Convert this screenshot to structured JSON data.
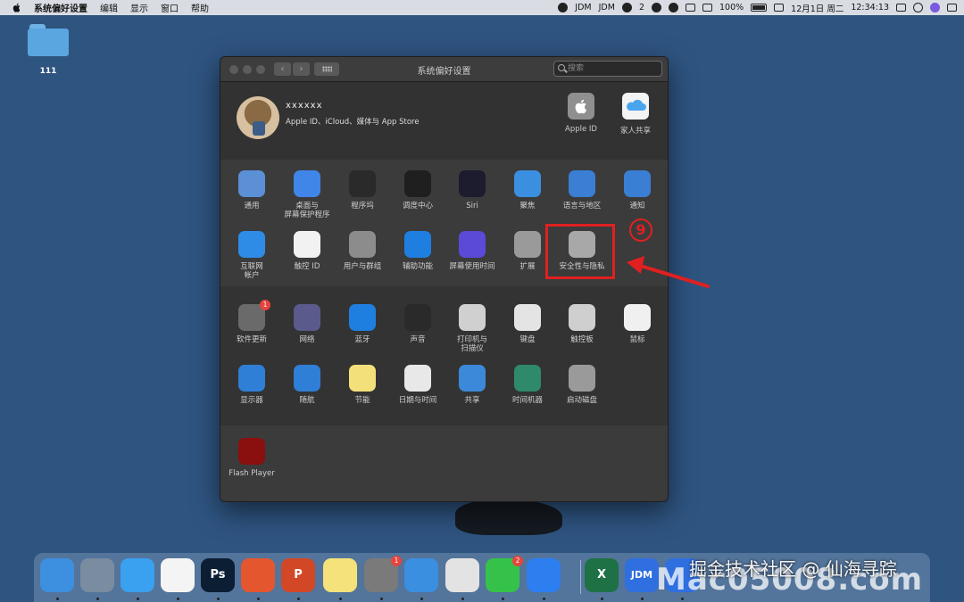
{
  "menubar": {
    "app_name": "系统偏好设置",
    "menus": [
      "编辑",
      "显示",
      "窗口",
      "帮助"
    ],
    "status": {
      "jdm1": "JDM",
      "jdm2": "JDM",
      "wechat_count": "2",
      "battery": "100%",
      "date": "12月1日 周二",
      "time": "12:34:13"
    }
  },
  "desktop": {
    "folder_label": "111"
  },
  "window": {
    "title": "系统偏好设置",
    "search_placeholder": "搜索",
    "user": {
      "name": "xxxxxx",
      "subtitle": "Apple ID、iCloud、媒体与 App Store"
    },
    "top_prefs": [
      {
        "label": "Apple ID",
        "icon": "apple-id-icon"
      },
      {
        "label": "家人共享",
        "icon": "family-sharing-icon"
      }
    ],
    "section_a": [
      {
        "label": "通用",
        "icon": "general-icon",
        "color": "#5b8fd6"
      },
      {
        "label": "桌面与\n屏幕保护程序",
        "icon": "desktop-screensaver-icon",
        "color": "#3f86e8"
      },
      {
        "label": "程序坞",
        "icon": "dock-icon",
        "color": "#2a2a2a"
      },
      {
        "label": "调度中心",
        "icon": "mission-control-icon",
        "color": "#1f1f1f"
      },
      {
        "label": "Siri",
        "icon": "siri-icon",
        "color": "#1c1c2e"
      },
      {
        "label": "聚焦",
        "icon": "spotlight-icon",
        "color": "#3a8fe0"
      },
      {
        "label": "语言与地区",
        "icon": "language-region-icon",
        "color": "#3a7fd4"
      },
      {
        "label": "通知",
        "icon": "notifications-icon",
        "color": "#3a7fd4"
      },
      {
        "label": "互联网\n帐户",
        "icon": "internet-accounts-icon",
        "color": "#2f8ce6"
      },
      {
        "label": "触控 ID",
        "icon": "touch-id-icon",
        "color": "#f2f2f2"
      },
      {
        "label": "用户与群组",
        "icon": "users-groups-icon",
        "color": "#8c8c8c"
      },
      {
        "label": "辅助功能",
        "icon": "accessibility-icon",
        "color": "#1f7fe0"
      },
      {
        "label": "屏幕使用时间",
        "icon": "screen-time-icon",
        "color": "#5b4ad6"
      },
      {
        "label": "扩展",
        "icon": "extensions-icon",
        "color": "#9a9a9a"
      },
      {
        "label": "安全性与隐私",
        "icon": "security-privacy-icon",
        "color": "#a8a8a8"
      }
    ],
    "section_b": [
      {
        "label": "软件更新",
        "icon": "software-update-icon",
        "color": "#6a6a6a",
        "badge": "1"
      },
      {
        "label": "网络",
        "icon": "network-icon",
        "color": "#5a5a8c"
      },
      {
        "label": "蓝牙",
        "icon": "bluetooth-icon",
        "color": "#1f7fe0"
      },
      {
        "label": "声音",
        "icon": "sound-icon",
        "color": "#2a2a2a"
      },
      {
        "label": "打印机与\n扫描仪",
        "icon": "printers-scanners-icon",
        "color": "#d0d0d0"
      },
      {
        "label": "键盘",
        "icon": "keyboard-icon",
        "color": "#e4e4e4"
      },
      {
        "label": "触控板",
        "icon": "trackpad-icon",
        "color": "#cfcfcf"
      },
      {
        "label": "鼠标",
        "icon": "mouse-icon",
        "color": "#f0f0f0"
      },
      {
        "label": "显示器",
        "icon": "displays-icon",
        "color": "#2f7fd6"
      },
      {
        "label": "随航",
        "icon": "sidecar-icon",
        "color": "#2f7fd6"
      },
      {
        "label": "节能",
        "icon": "energy-saver-icon",
        "color": "#f3e07a"
      },
      {
        "label": "日期与时间",
        "icon": "date-time-icon",
        "color": "#e8e8e8"
      },
      {
        "label": "共享",
        "icon": "sharing-icon",
        "color": "#3d89d9"
      },
      {
        "label": "时间机器",
        "icon": "time-machine-icon",
        "color": "#2e8a6a"
      },
      {
        "label": "启动磁盘",
        "icon": "startup-disk-icon",
        "color": "#9a9a9a"
      }
    ],
    "section_c": [
      {
        "label": "Flash Player",
        "icon": "flash-player-icon",
        "color": "#8a1010"
      }
    ]
  },
  "annotation": {
    "step_number": "9"
  },
  "dock": {
    "apps": [
      {
        "name": "finder-icon",
        "color": "#3d8fe0",
        "text": ""
      },
      {
        "name": "launchpad-icon",
        "color": "#7a8ca0",
        "text": ""
      },
      {
        "name": "messages-icon",
        "color": "#3aa0f0",
        "text": ""
      },
      {
        "name": "reminders-icon",
        "color": "#f4f4f4",
        "text": ""
      },
      {
        "name": "photoshop-icon",
        "color": "#0b1e33",
        "text": "Ps"
      },
      {
        "name": "xmind-icon",
        "color": "#e4572e",
        "text": ""
      },
      {
        "name": "powerpoint-icon",
        "color": "#d24726",
        "text": "P"
      },
      {
        "name": "notes-icon",
        "color": "#f6e27a",
        "text": ""
      },
      {
        "name": "system-preferences-icon",
        "color": "#7a7a7a",
        "text": "",
        "badge": "1"
      },
      {
        "name": "safari-icon",
        "color": "#3b8fe0",
        "text": ""
      },
      {
        "name": "chrome-icon",
        "color": "#e3e3e3",
        "text": ""
      },
      {
        "name": "wechat-icon",
        "color": "#36c24a",
        "text": "",
        "badge": "2"
      },
      {
        "name": "feishu-icon",
        "color": "#2d7ff0",
        "text": ""
      },
      {
        "name": "excel-icon",
        "color": "#1e7145",
        "text": "X"
      },
      {
        "name": "jdm-icon",
        "color": "#2f6fe0",
        "text": "JDM"
      },
      {
        "name": "jdm-secondary-icon",
        "color": "#2f6fe0",
        "text": ""
      }
    ]
  },
  "watermark": {
    "text": "掘金技术社区 @ 仙海寻踪",
    "background_text": "Mac05008.com"
  }
}
